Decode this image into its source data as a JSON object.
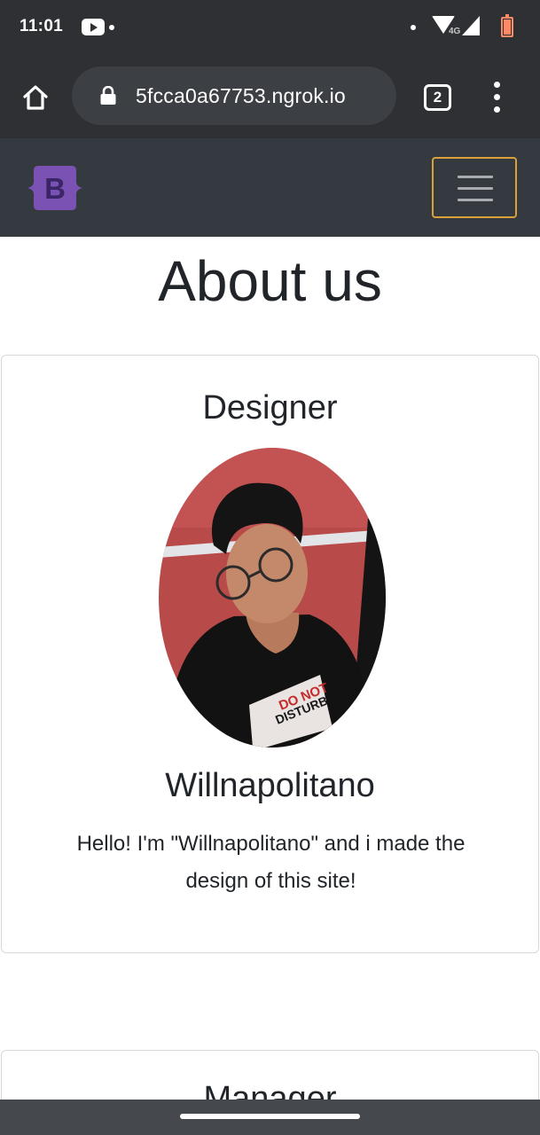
{
  "status_bar": {
    "time": "11:01",
    "network": "4G"
  },
  "browser": {
    "url": "5fcca0a67753.ngrok.io",
    "tab_count": "2"
  },
  "navbar": {
    "brand_letter": "B",
    "brand_color": "#7952b3"
  },
  "page": {
    "title": "About us"
  },
  "cards": [
    {
      "role": "Designer",
      "name": "Willnapolitano",
      "description": "Hello! I'm \"Willnapolitano\" and i made the design of this site!",
      "photo_shirt_text": "DO NOT DISTURB"
    },
    {
      "role": "Manager"
    }
  ],
  "colors": {
    "chrome_bg": "#2e3033",
    "navbar_bg": "#343a40",
    "toggler_focus": "#d8a13b",
    "text": "#212529"
  }
}
